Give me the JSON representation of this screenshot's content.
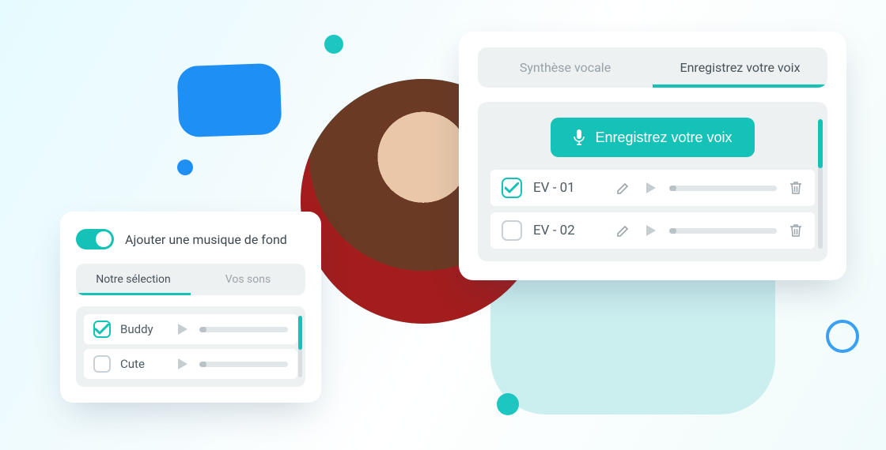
{
  "colors": {
    "accent": "#15c2b8",
    "blue": "#1e90f5",
    "text": "#4e5a61",
    "muted": "#97a2a8"
  },
  "voice_card": {
    "tabs": {
      "tts": "Synthèse vocale",
      "record": "Enregistrez votre voix"
    },
    "record_button": "Enregistrez votre voix",
    "recordings": [
      {
        "name": "EV - 01",
        "checked": true
      },
      {
        "name": "EV - 02",
        "checked": false
      }
    ]
  },
  "music_card": {
    "toggle_label": "Ajouter une musique de fond",
    "toggle_on": true,
    "tabs": {
      "selection": "Notre sélection",
      "yours": "Vos sons"
    },
    "tracks": [
      {
        "name": "Buddy",
        "checked": true
      },
      {
        "name": "Cute",
        "checked": false
      }
    ]
  }
}
